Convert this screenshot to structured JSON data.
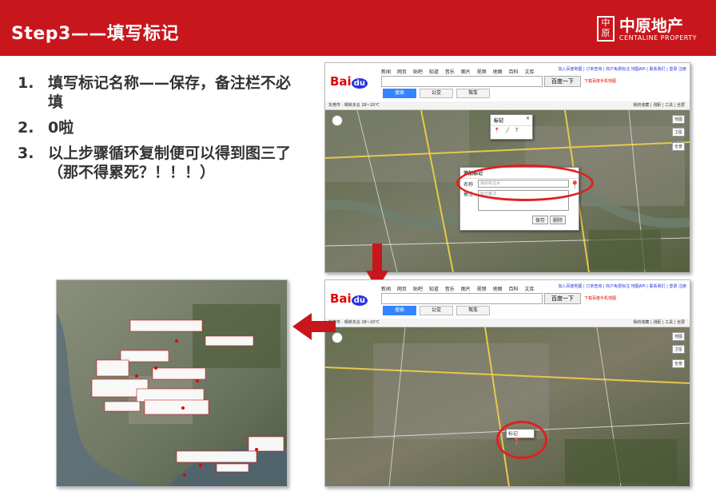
{
  "header": {
    "title": "Step3——填写标记",
    "logo": {
      "seal": "中原",
      "name": "中原地产",
      "english": "CENTALINE PROPERTY"
    }
  },
  "steps": [
    {
      "num": "1.",
      "text": "填写标记名称——保存，备注栏不必填"
    },
    {
      "num": "2.",
      "text": "0啦"
    },
    {
      "num": "3.",
      "text": "以上步骤循环复制便可以得到图三了（那不得累死？！！！）"
    }
  ],
  "baidu_map": {
    "logo_bai": "Bai",
    "logo_du": "du",
    "logo_map": "地图",
    "nav_links": [
      "新闻",
      "网页",
      "贴吧",
      "知道",
      "音乐",
      "图片",
      "视频",
      "地图",
      "百科",
      "文库"
    ],
    "top_links": "加入百度地图 | 订单查询 | 商户免费标注 地图API | 联系我们 | 登录 注册",
    "search_button": "百度一下",
    "download_link": "下载百度手机地图",
    "tabs": [
      "搜索",
      "公交",
      "驾车"
    ],
    "city_bar": "东莞市 · 晴转多云 28~20℃",
    "city_bar_right": "我的收藏 | 测距 | 工具 | 全屏",
    "map_controls": {
      "map_type": "地图",
      "satellite": "卫星",
      "full": "全景"
    }
  },
  "dialogs": {
    "marker_tool": {
      "title": "标记",
      "icons": [
        "📍",
        "╱",
        "T"
      ]
    },
    "add_marker": {
      "title": "添加标记",
      "name_label": "名称",
      "name_value": "我的标注点",
      "note_label": "备注",
      "note_value": "标记备注",
      "save": "保存",
      "delete": "删除"
    },
    "saved_marker": {
      "title": "标记"
    }
  },
  "colors": {
    "brand_red": "#c8161d",
    "baidu_blue": "#2932e1",
    "highlight_ring": "#e02020"
  }
}
